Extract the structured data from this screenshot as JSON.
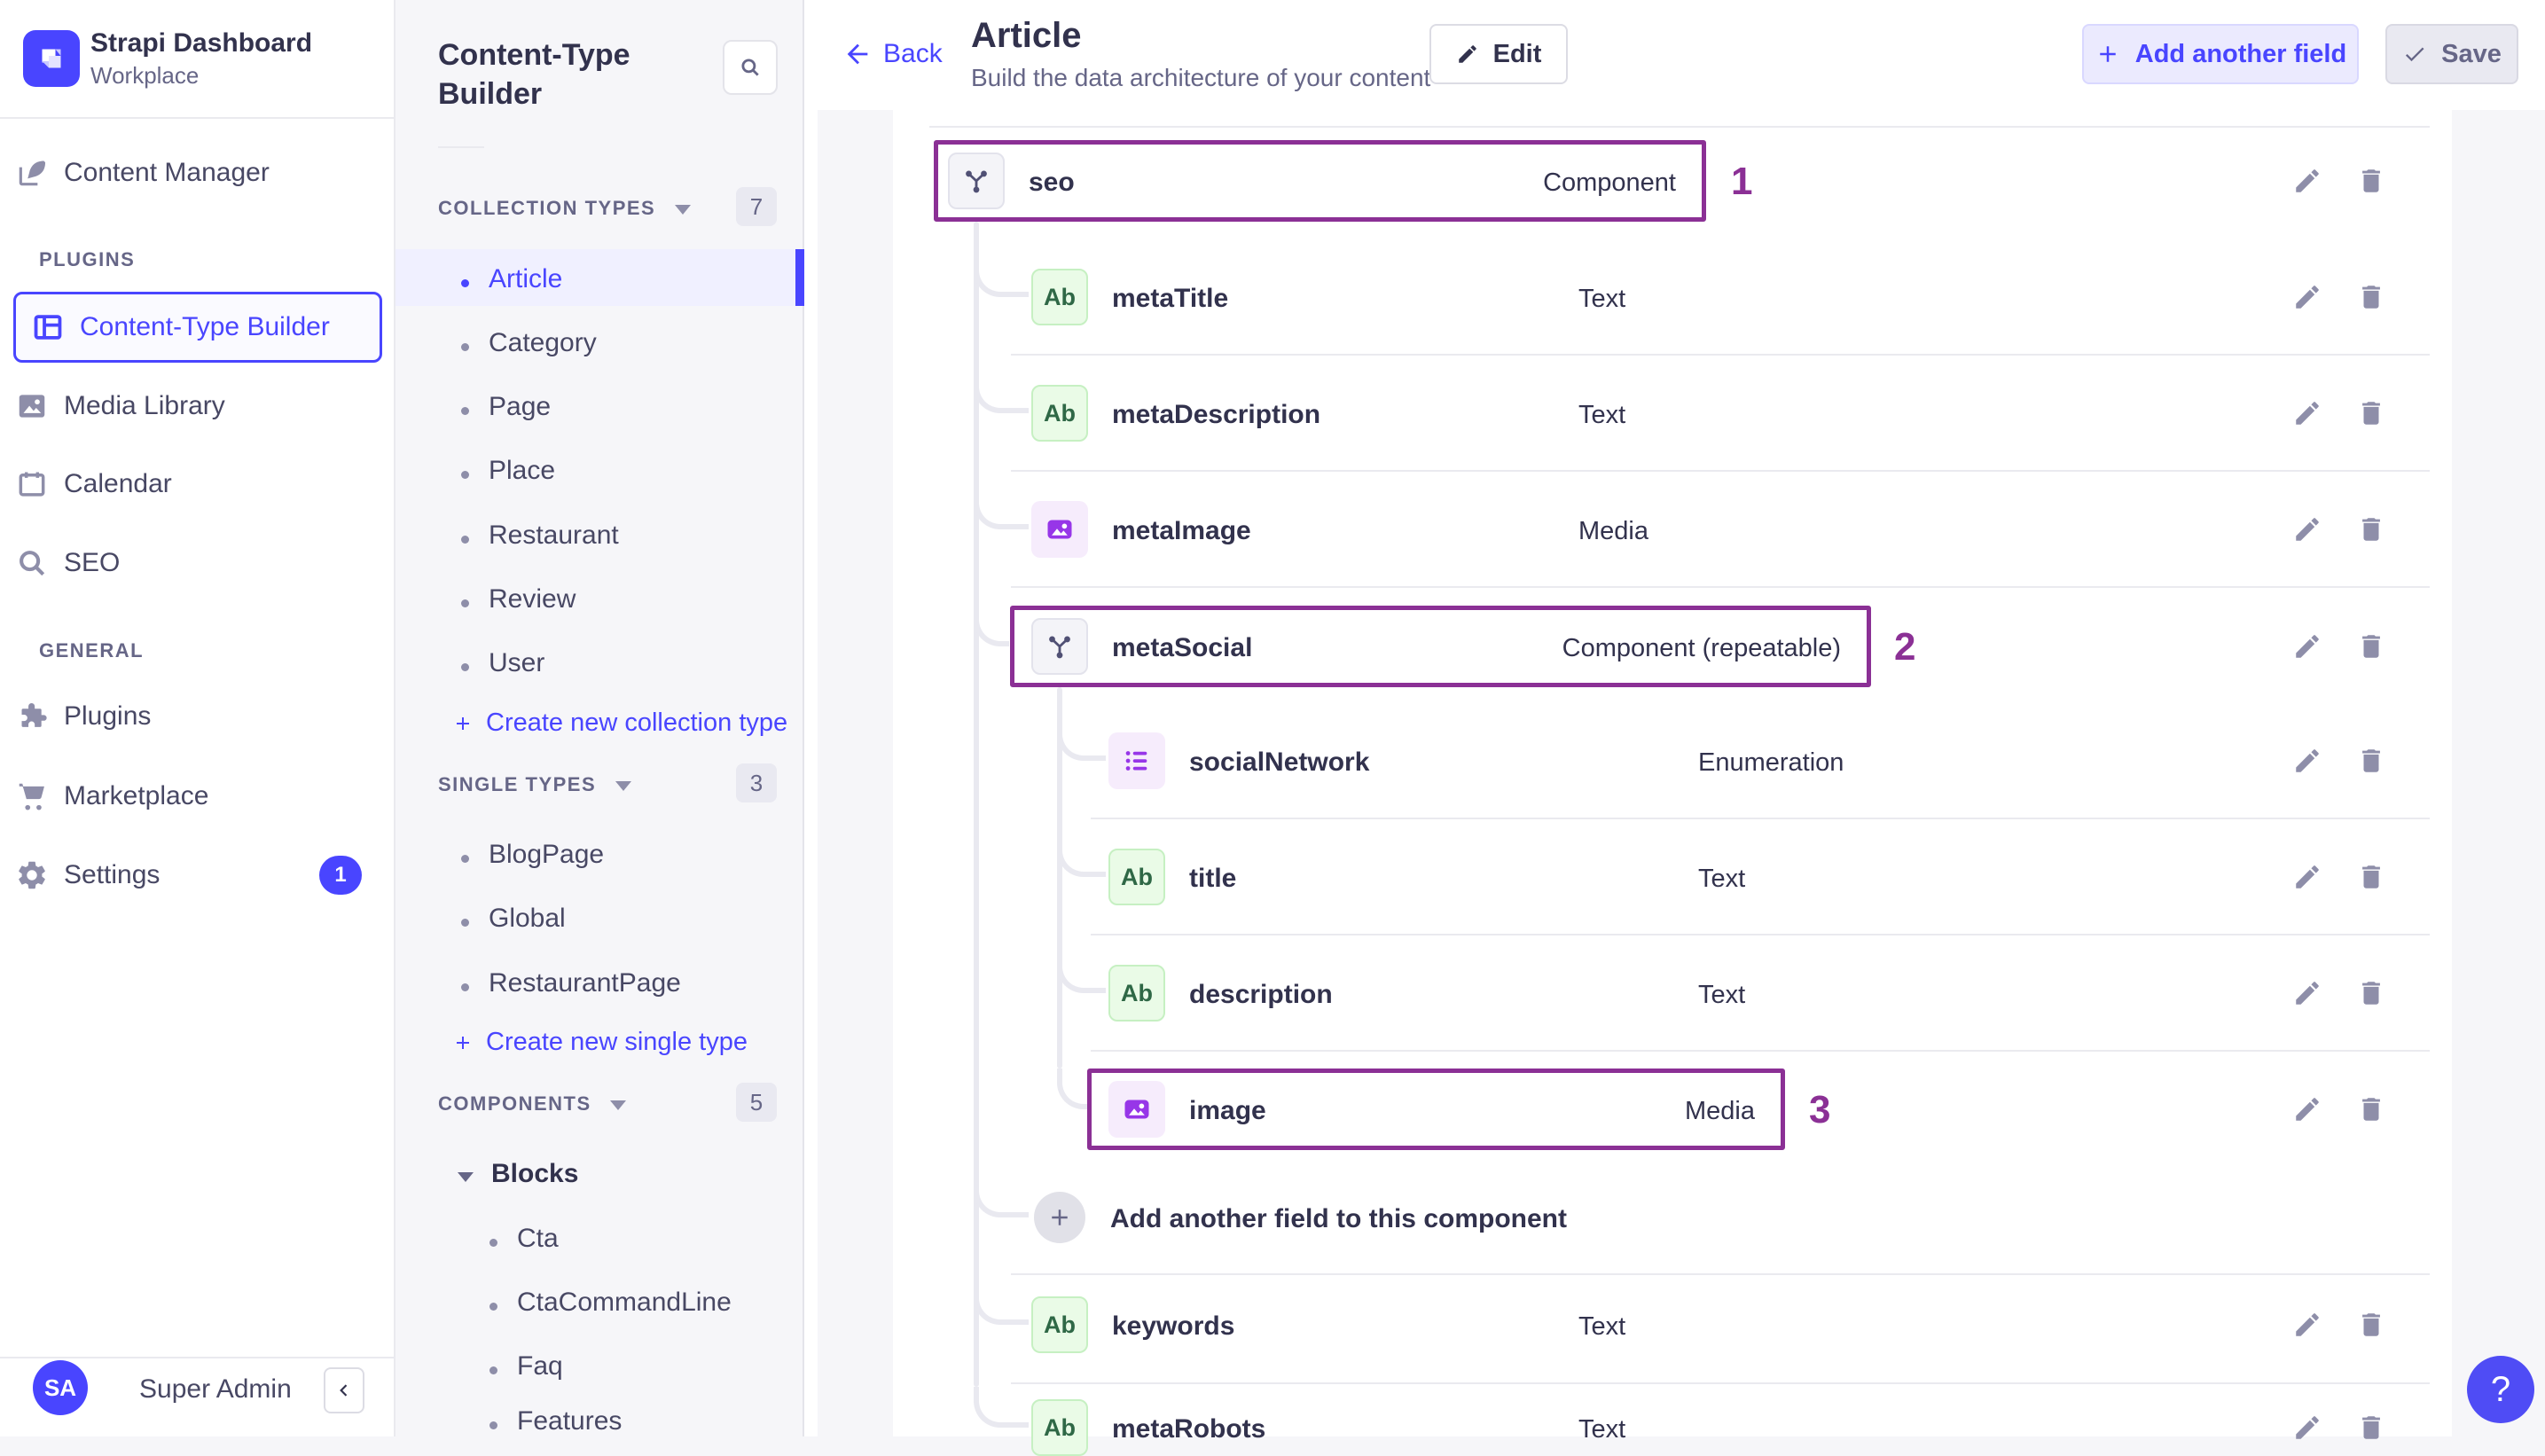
{
  "brand": {
    "title": "Strapi Dashboard",
    "subtitle": "Workplace"
  },
  "left_nav": {
    "content_manager": "Content Manager",
    "plugins_section": "PLUGINS",
    "plugins_items": {
      "ctb": "Content-Type Builder",
      "media": "Media Library",
      "calendar": "Calendar",
      "seo": "SEO"
    },
    "general_section": "GENERAL",
    "general_items": {
      "plugins": "Plugins",
      "marketplace": "Marketplace",
      "settings": "Settings"
    },
    "settings_badge": "1",
    "user": {
      "initials": "SA",
      "name": "Super Admin"
    }
  },
  "sub_nav": {
    "title": "Content-Type Builder",
    "collection": {
      "label": "COLLECTION TYPES",
      "count": "7",
      "items": [
        "Article",
        "Category",
        "Page",
        "Place",
        "Restaurant",
        "Review",
        "User"
      ],
      "create": "Create new collection type"
    },
    "single": {
      "label": "SINGLE TYPES",
      "count": "3",
      "items": [
        "BlogPage",
        "Global",
        "RestaurantPage"
      ],
      "create": "Create new single type"
    },
    "components": {
      "label": "COMPONENTS",
      "count": "5",
      "group": "Blocks",
      "items": [
        "Cta",
        "CtaCommandLine",
        "Faq",
        "Features"
      ]
    }
  },
  "header": {
    "back": "Back",
    "title": "Article",
    "subtitle": "Build the data architecture of your content",
    "edit": "Edit",
    "add_field": "Add another field",
    "save": "Save"
  },
  "fields": [
    {
      "name": "seo",
      "type": "Component",
      "annotation": "1"
    },
    {
      "name": "metaTitle",
      "type": "Text"
    },
    {
      "name": "metaDescription",
      "type": "Text"
    },
    {
      "name": "metaImage",
      "type": "Media"
    },
    {
      "name": "metaSocial",
      "type": "Component (repeatable)",
      "annotation": "2"
    },
    {
      "name": "socialNetwork",
      "type": "Enumeration"
    },
    {
      "name": "title",
      "type": "Text"
    },
    {
      "name": "description",
      "type": "Text"
    },
    {
      "name": "image",
      "type": "Media",
      "annotation": "3"
    },
    {
      "name": "keywords",
      "type": "Text"
    },
    {
      "name": "metaRobots",
      "type": "Text"
    }
  ],
  "add_component_row": "Add another field to this component",
  "help": "?",
  "colors": {
    "accent": "#4945ff",
    "annotation": "#8b3095",
    "active_bg": "#f0f0ff"
  }
}
